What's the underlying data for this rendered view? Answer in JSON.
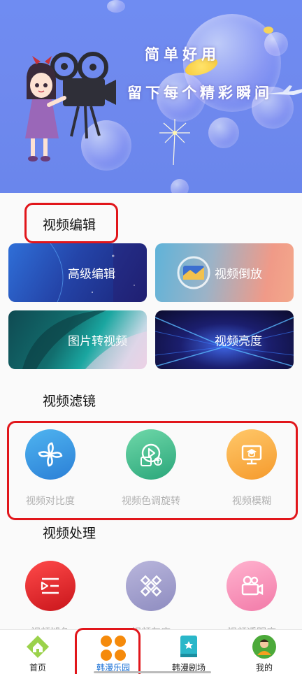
{
  "banner": {
    "line1": "简单好用",
    "line2": "留下每个精彩瞬间"
  },
  "sections": {
    "edit": {
      "title": "视频编辑",
      "cards": [
        {
          "label": "高级编辑"
        },
        {
          "label": "视频倒放"
        },
        {
          "label": "图片转视频"
        },
        {
          "label": "视频亮度"
        }
      ]
    },
    "filter": {
      "title": "视频滤镜",
      "items": [
        {
          "label": "视频对比度",
          "icon": "fan-icon"
        },
        {
          "label": "视频色调旋转",
          "icon": "video-rotate-icon"
        },
        {
          "label": "视频模糊",
          "icon": "monitor-icon"
        }
      ]
    },
    "process": {
      "title": "视频处理",
      "items": [
        {
          "label": "视频褪色",
          "icon": "play-list-icon"
        },
        {
          "label": "视频灰度",
          "icon": "gray-icon"
        },
        {
          "label": "视频透明度",
          "icon": "camera-icon"
        }
      ]
    }
  },
  "tabbar": {
    "tabs": [
      {
        "label": "首页",
        "icon": "home-icon"
      },
      {
        "label": "韩漫乐园",
        "icon": "grid-icon",
        "active": true
      },
      {
        "label": "韩漫剧场",
        "icon": "book-icon"
      },
      {
        "label": "我的",
        "icon": "avatar-icon"
      }
    ]
  },
  "colors": {
    "accent_red": "#e1161b",
    "active_tab": "#1e73d6",
    "banner_blue": "#6f8cf2"
  }
}
